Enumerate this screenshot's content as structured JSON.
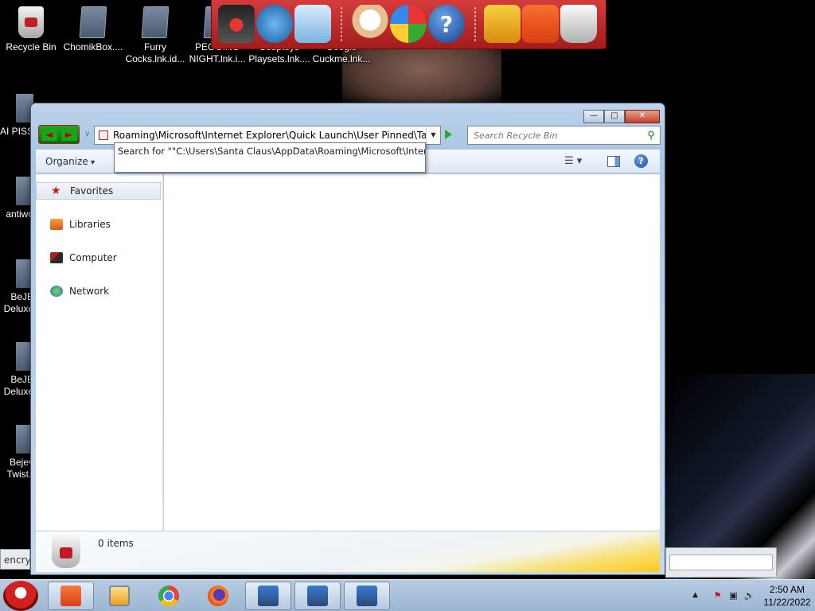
{
  "desktop": {
    "icons": [
      {
        "label": "Recycle Bin"
      },
      {
        "label": "ChomikBox...."
      },
      {
        "label": "Furry Cocks.lnk.id..."
      },
      {
        "label": "PEGGING NIGHT.lnk.i..."
      },
      {
        "label": "Souptoys Playsets.lnk...."
      },
      {
        "label": "Google Cuckme.lnk..."
      }
    ],
    "left_icons": [
      {
        "label": "AI PISS.In"
      },
      {
        "label": "antiwo"
      },
      {
        "label": "BeJE Deluxe"
      },
      {
        "label": "BeJE Deluxe"
      },
      {
        "label": "Bejev Twist.l"
      }
    ],
    "behind_window_text": "encryp"
  },
  "top_toolbar": {
    "buttons": [
      {
        "icon": "santa-computer-icon"
      },
      {
        "icon": "globe-network-icon"
      },
      {
        "icon": "control-panel-icon"
      },
      {
        "icon": "snowman-icon"
      },
      {
        "icon": "windows-shield-icon"
      },
      {
        "icon": "help-icon",
        "glyph": "?"
      },
      {
        "icon": "gift-icon"
      },
      {
        "icon": "folder-icon"
      },
      {
        "icon": "recycle-bin-icon"
      }
    ]
  },
  "explorer": {
    "caption": {
      "minimize": "—",
      "maximize": "□",
      "close": "✕"
    },
    "nav": {
      "back": "◄",
      "forward": "►",
      "recent": "∨"
    },
    "address": {
      "path": "Roaming\\Microsoft\\Internet Explorer\\Quick Launch\\User Pinned\\TaskBar\\",
      "suggestion": "Search for \"\"C:\\Users\\Santa Claus\\AppData\\Roaming\\Microsoft\\Internet"
    },
    "search": {
      "placeholder": "Search Recycle Bin"
    },
    "commandbar": {
      "organize": "Organize",
      "views_glyph": "☰ ▾",
      "help": "?"
    },
    "navpane": {
      "items": [
        {
          "label": "Favorites",
          "icon": "star-icon",
          "selected": true
        },
        {
          "label": "Libraries",
          "icon": "libraries-icon"
        },
        {
          "label": "Computer",
          "icon": "computer-icon"
        },
        {
          "label": "Network",
          "icon": "network-icon"
        }
      ]
    },
    "details": {
      "count": "0 items"
    }
  },
  "taskbar": {
    "buttons": [
      {
        "name": "file-explorer",
        "icon": "folder-icon",
        "active": true
      },
      {
        "name": "media-player",
        "icon": "media-player-icon"
      },
      {
        "name": "chrome",
        "icon": "chrome-icon"
      },
      {
        "name": "firefox",
        "icon": "firefox-icon"
      },
      {
        "name": "network-app-1",
        "icon": "network-computer-icon"
      },
      {
        "name": "network-app-2",
        "icon": "network-computer-icon"
      },
      {
        "name": "network-app-3",
        "icon": "network-computer-icon"
      }
    ],
    "clock": {
      "time": "2:50 AM",
      "date": "11/22/2022"
    }
  },
  "colors": {
    "toolbar": "#c42a2a",
    "window_frame": "#aac6e2",
    "taskbar": "#a8c0da",
    "go_arrow": "#2aa82a"
  }
}
